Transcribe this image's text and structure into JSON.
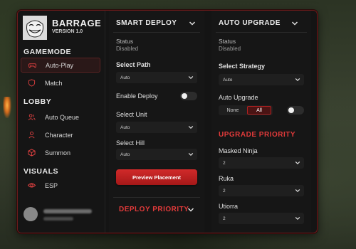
{
  "app": {
    "name": "BARRAGE",
    "version": "VERSION 1.0"
  },
  "sidebar": {
    "sections": [
      {
        "title": "GAMEMODE",
        "items": [
          {
            "label": "Auto-Play",
            "icon": "gamepad-icon",
            "active": true
          },
          {
            "label": "Match",
            "icon": "shield-icon",
            "active": false
          }
        ]
      },
      {
        "title": "LOBBY",
        "items": [
          {
            "label": "Auto Queue",
            "icon": "users-icon",
            "active": false
          },
          {
            "label": "Character",
            "icon": "user-icon",
            "active": false
          },
          {
            "label": "Summon",
            "icon": "box-icon",
            "active": false
          }
        ]
      },
      {
        "title": "VISUALS",
        "items": [
          {
            "label": "ESP",
            "icon": "eye-icon",
            "active": false
          }
        ]
      }
    ]
  },
  "smart_deploy": {
    "title": "SMART DEPLOY",
    "status_label": "Status",
    "status_value": "Disabled",
    "path_label": "Select Path",
    "path_value": "Auto",
    "enable_label": "Enable Deploy",
    "enable_on": false,
    "unit_label": "Select Unit",
    "unit_value": "Auto",
    "hill_label": "Select Hill",
    "hill_value": "Auto",
    "preview_button": "Preview Placement",
    "priority_title": "DEPLOY PRIORITY"
  },
  "auto_upgrade": {
    "title": "AUTO UPGRADE",
    "status_label": "Status",
    "status_value": "Disabled",
    "strategy_label": "Select Strategy",
    "strategy_value": "Auto",
    "auto_upgrade_label": "Auto Upgrade",
    "options": [
      "None",
      "All"
    ],
    "selected_option": "All",
    "toggle_on": false,
    "priority_title": "UPGRADE PRIORITY",
    "priority_items": [
      {
        "label": "Masked Ninja",
        "value": "2"
      },
      {
        "label": "Ruka",
        "value": "2"
      },
      {
        "label": "Utiorra",
        "value": "2"
      }
    ]
  },
  "colors": {
    "accent": "#d12a2a",
    "accent_text": "#e23a3a",
    "panel": "#161616",
    "border": "#6b1a1a"
  }
}
